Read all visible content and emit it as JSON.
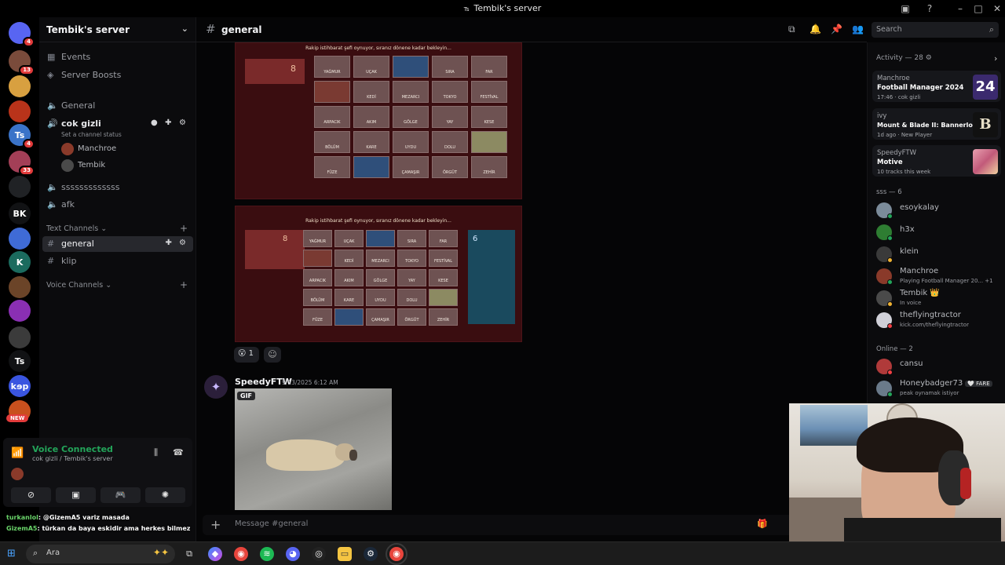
{
  "window": {
    "title": "Tembik's server",
    "app_tag": "Ts"
  },
  "rail": {
    "servers": [
      {
        "label": "",
        "badge": "4",
        "color": "#5865f2",
        "icon": "discord-icon"
      },
      {
        "label": "",
        "badge": "13",
        "color": "#7a4b3b",
        "icon": "server-avatar"
      },
      {
        "label": "",
        "badge": "",
        "color": "#d8a040",
        "icon": "server-avatar"
      },
      {
        "label": "",
        "badge": "",
        "color": "#b9331a",
        "icon": "server-avatar"
      },
      {
        "label": "Ts",
        "badge": "4",
        "color": "#3a73c8",
        "icon": "server-initials"
      },
      {
        "label": "",
        "badge": "33",
        "color": "#a33f57",
        "icon": "server-avatar"
      },
      {
        "label": "",
        "badge": "",
        "color": "#202225",
        "icon": "server-avatar"
      },
      {
        "label": "BK",
        "badge": "",
        "color": "#111214",
        "icon": "server-initials"
      },
      {
        "label": "",
        "badge": "",
        "color": "#3f6bd6",
        "icon": "server-avatar"
      },
      {
        "label": "K",
        "badge": "",
        "color": "#1b6b5e",
        "icon": "server-initials"
      },
      {
        "label": "",
        "badge": "",
        "color": "#6b4428",
        "icon": "server-avatar"
      },
      {
        "label": "",
        "badge": "",
        "color": "#8a2fb3",
        "icon": "server-avatar"
      },
      {
        "label": "",
        "badge": "",
        "color": "#3b3b3b",
        "icon": "server-avatar"
      },
      {
        "label": "Ts",
        "badge": "",
        "color": "#111214",
        "icon": "server-initials"
      },
      {
        "label": "kɘp",
        "badge": "",
        "color": "#3a55e0",
        "icon": "server-initials"
      },
      {
        "label": "",
        "badge": "",
        "color": "#c8501e",
        "icon": "server-avatar"
      }
    ],
    "new_label": "NEW"
  },
  "sidebar": {
    "server_name": "Tembik's server",
    "events": "Events",
    "boosts": "Server Boosts",
    "voice_general": "General",
    "voice_active": "cok gizli",
    "channel_status": "Set a channel status",
    "voice_users": [
      "Manchroe",
      "Tembik"
    ],
    "voice_ss": "sssssssssssss",
    "voice_afk": "afk",
    "text_category": "Text Channels",
    "text_channels": [
      "general",
      "klip"
    ],
    "voice_category": "Voice Channels"
  },
  "voice_panel": {
    "status": "Voice Connected",
    "sub": "cok gizli / Tembik's server"
  },
  "overlay_chat": [
    {
      "user": "turkanlol",
      "text": ": @GizemA5 variz masada"
    },
    {
      "user": "GizemA5",
      "text": ": türkan da baya eskidir ama herkes bilmez"
    }
  ],
  "channel": {
    "name": "general",
    "search_placeholder": "Search"
  },
  "game": {
    "banner": "Rakip istihbarat şefi oynuyor, sıranız dönene kadar bekleyin...",
    "score_red": "8",
    "score_blue": "6",
    "words": [
      "YAĞMUR",
      "UÇAK",
      "",
      "SIRA",
      "FAR",
      "",
      "KEDİ",
      "MEZARCI",
      "TOKYO",
      "FESTİVAL",
      "ARPACIK",
      "AKIM",
      "GÖLGE",
      "YAY",
      "KESE",
      "BÖLÜM",
      "KARE",
      "UYDU",
      "DOLU",
      "",
      "FÜZE",
      "",
      "ÇAMAŞIR",
      "ÖRGÜT",
      "ZEHİR"
    ]
  },
  "reaction": {
    "emoji": "😮",
    "count": "1"
  },
  "message": {
    "author": "SpeedyFTW",
    "time": "9/13/2025 6:12 AM",
    "gif_label": "GIF"
  },
  "composer": {
    "placeholder": "Message #general"
  },
  "members": {
    "activity_title": "Activity — 28",
    "activities": [
      {
        "who": "Manchroe",
        "game": "Football Manager 2024",
        "meta": "17:46 · cok gizli",
        "thumb": "24",
        "thumb_bg": "#3b2a6e"
      },
      {
        "who": "ivy",
        "game": "Mount & Blade II: Bannerlord",
        "meta": "1d ago · New Player",
        "thumb": "B",
        "thumb_bg": "#1a1a1a"
      },
      {
        "who": "SpeedyFTW",
        "game": "Motive",
        "meta": "10 tracks this week",
        "thumb": "",
        "thumb_bg": "#c25a7a"
      }
    ],
    "group1": "sss — 6",
    "sss": [
      {
        "name": "esoykalay",
        "sub": "",
        "color": "#7b8b9a",
        "status": "#23a55a"
      },
      {
        "name": "h3x",
        "sub": "",
        "color": "#2e7d32",
        "status": "#23a55a"
      },
      {
        "name": "klein",
        "sub": "",
        "color": "#3a3a3a",
        "status": "#f0b232"
      },
      {
        "name": "Manchroe",
        "sub": "Playing Football Manager 20... +1",
        "color": "#8a3a2a",
        "status": "#23a55a"
      },
      {
        "name": "Tembik 👑",
        "sub": "In voice",
        "color": "#4a4a4a",
        "status": "#f0b232"
      },
      {
        "name": "theflyingtractor",
        "sub": "kick.com/theflyingtractor",
        "color": "#d0d0d8",
        "status": "#f23f43"
      }
    ],
    "group2": "Online — 2",
    "online": [
      {
        "name": "cansu",
        "sub": "",
        "color": "#b03a3a",
        "status": "#f23f43"
      },
      {
        "name": "Honeybadger73",
        "sub": "peak oynamak istiyor",
        "color": "#6a7a8a",
        "status": "#23a55a",
        "tag": "🤍 FARE"
      }
    ]
  },
  "taskbar": {
    "search": "Ara"
  }
}
